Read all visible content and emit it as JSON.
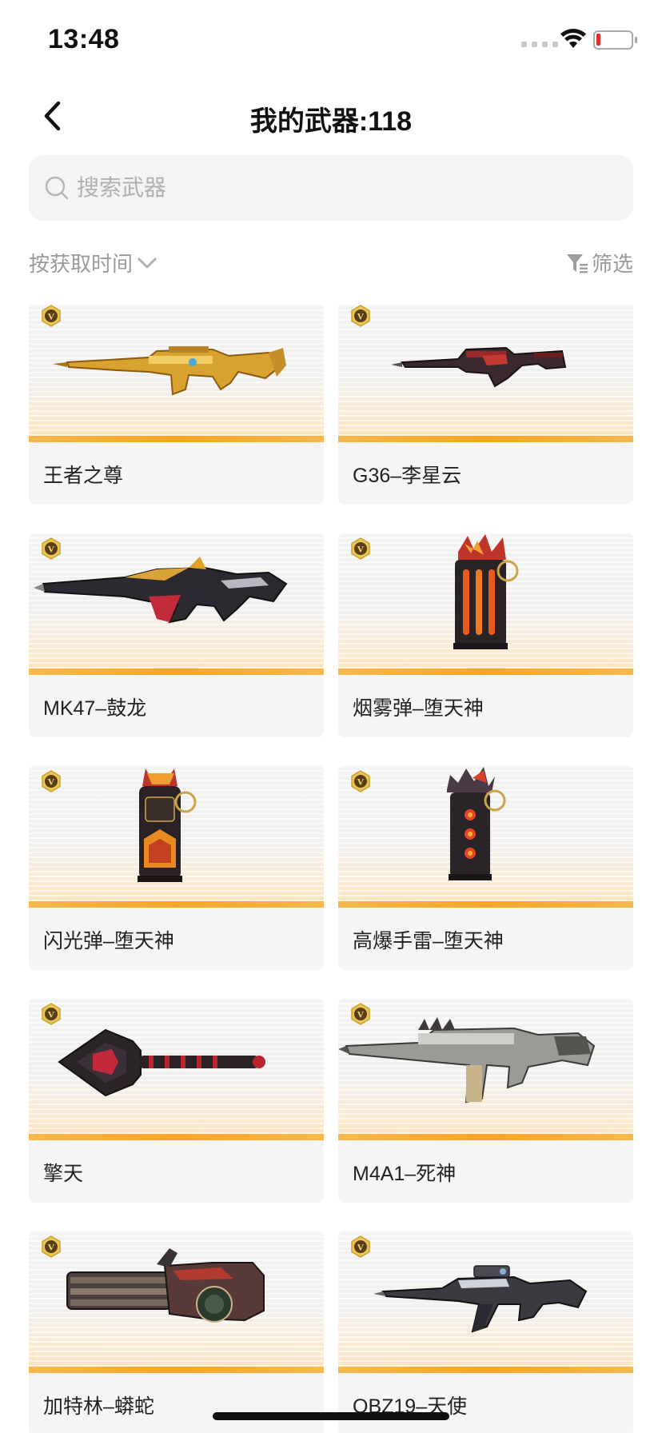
{
  "status_bar": {
    "time": "13:48"
  },
  "nav": {
    "title": "我的武器:118"
  },
  "search": {
    "placeholder": "搜索武器"
  },
  "sort": {
    "label": "按获取时间"
  },
  "filter": {
    "label": "筛选"
  },
  "weapons": [
    {
      "name": "王者之尊",
      "badge": "V"
    },
    {
      "name": "G36–李星云",
      "badge": "V"
    },
    {
      "name": "MK47–鼓龙",
      "badge": "V"
    },
    {
      "name": "烟雾弹–堕天神",
      "badge": "V"
    },
    {
      "name": "闪光弹–堕天神",
      "badge": "V"
    },
    {
      "name": "高爆手雷–堕天神",
      "badge": "V"
    },
    {
      "name": "擎天",
      "badge": "V"
    },
    {
      "name": "M4A1–死神",
      "badge": "V"
    },
    {
      "name": "加特林–蟒蛇",
      "badge": "V"
    },
    {
      "name": "QBZ19–天使",
      "badge": "V"
    }
  ],
  "colors": {
    "accent_bar": "#f5a524",
    "badge_gold": "#c9a227",
    "card_bg": "#f5f5f5"
  }
}
